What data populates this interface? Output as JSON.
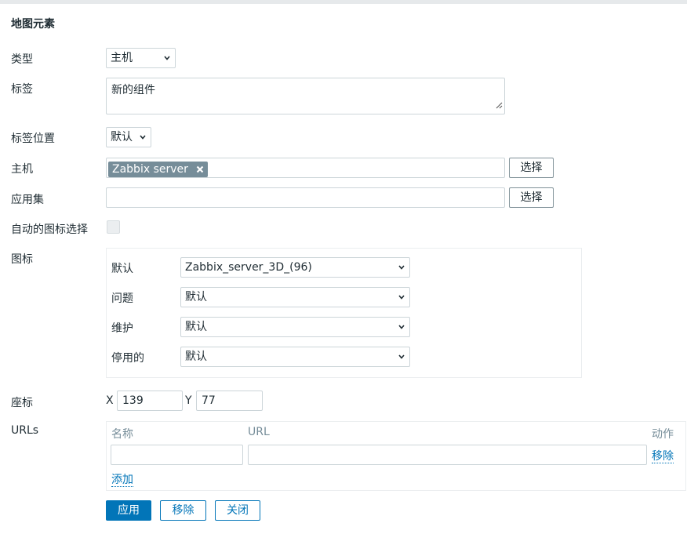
{
  "dialog": {
    "title": "地图元素"
  },
  "fields": {
    "type": {
      "label": "类型",
      "value": "主机"
    },
    "label": {
      "label": "标签",
      "value": "新的组件"
    },
    "label_location": {
      "label": "标签位置",
      "value": "默认"
    },
    "host": {
      "label": "主机",
      "chip": "Zabbix server",
      "select_label": "选择"
    },
    "application": {
      "label": "应用集",
      "value": "",
      "select_label": "选择"
    },
    "auto_icon": {
      "label": "自动的图标选择",
      "checked": false
    },
    "icons": {
      "label": "图标",
      "rows": [
        {
          "label": "默认",
          "value": "Zabbix_server_3D_(96)"
        },
        {
          "label": "问题",
          "value": "默认"
        },
        {
          "label": "维护",
          "value": "默认"
        },
        {
          "label": "停用的",
          "value": "默认"
        }
      ]
    },
    "coordinates": {
      "label": "座标",
      "x_label": "X",
      "x_value": "139",
      "y_label": "Y",
      "y_value": "77"
    },
    "urls": {
      "label": "URLs",
      "col_name": "名称",
      "col_url": "URL",
      "col_action": "动作",
      "row": {
        "name": "",
        "url": "",
        "remove_label": "移除"
      },
      "add_label": "添加"
    }
  },
  "buttons": {
    "apply": "应用",
    "remove": "移除",
    "close": "关闭"
  },
  "colors": {
    "accent": "#0275b8",
    "chip_bg": "#768d99",
    "border": "#ccd5d9"
  }
}
